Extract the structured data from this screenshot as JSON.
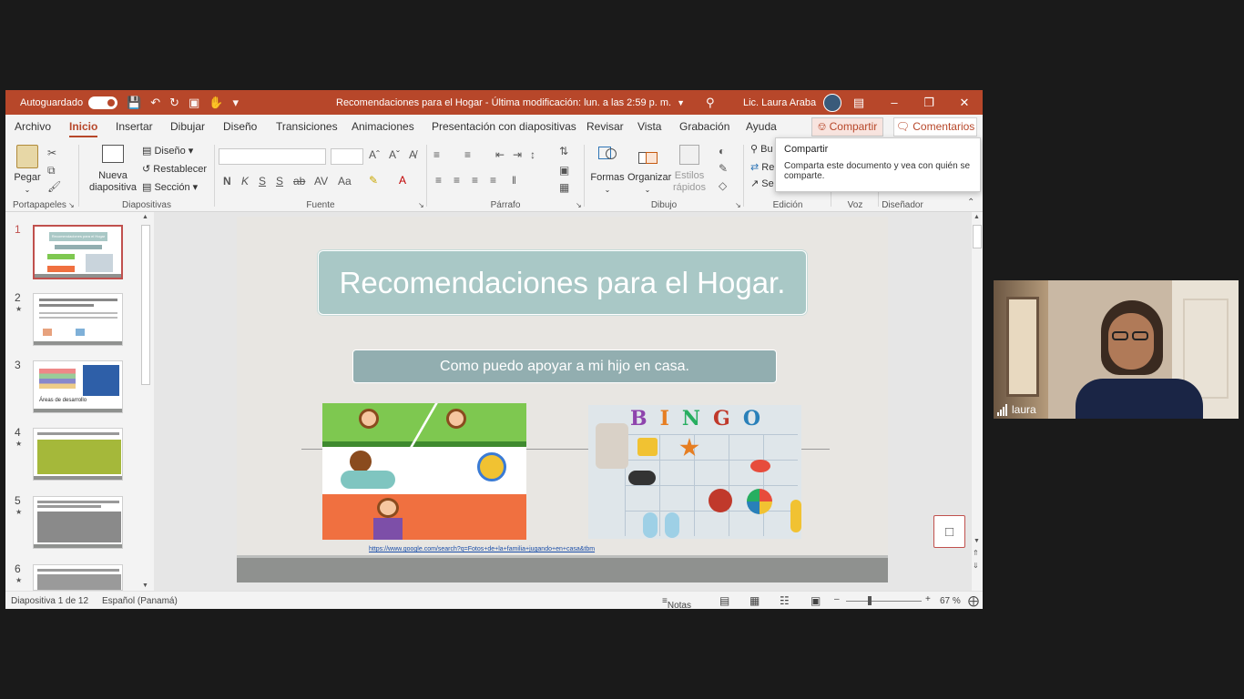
{
  "titlebar": {
    "autosave_label": "Autoguardado",
    "document_title": "Recomendaciones para el Hogar  -  Última modificación: lun. a las 2:59 p. m.",
    "user_name": "Lic. Laura Araba"
  },
  "menu": {
    "tabs": [
      "Archivo",
      "Inicio",
      "Insertar",
      "Dibujar",
      "Diseño",
      "Transiciones",
      "Animaciones",
      "Presentación con diapositivas",
      "Revisar",
      "Vista",
      "Grabación",
      "Ayuda"
    ],
    "active_tab": "Inicio",
    "share_label": "Compartir",
    "comments_label": "Comentarios"
  },
  "ribbon": {
    "paste_label": "Pegar",
    "new_slide_label": "Nueva diapositiva",
    "layout_label": "Diseño",
    "reset_label": "Restablecer",
    "section_label": "Sección",
    "shapes_label": "Formas",
    "arrange_label": "Organizar",
    "quick_styles_label": "Estilos rápidos",
    "find_label": "Bu",
    "replace_label": "Re",
    "select_label": "Se",
    "groups": {
      "portapapeles": "Portapapeles",
      "diapositivas": "Diapositivas",
      "fuente": "Fuente",
      "parrafo": "Párrafo",
      "dibujo": "Dibujo",
      "edicion": "Edición",
      "voz": "Voz",
      "disenador": "Diseñador"
    }
  },
  "tooltip": {
    "title": "Compartir",
    "body": "Comparta este documento y vea con quién se comparte."
  },
  "slides": {
    "numbers": [
      "1",
      "2",
      "3",
      "4",
      "5",
      "6"
    ],
    "thumb1_title": "Recomendaciones para el Hogar",
    "thumb3_caption": "Áreas de desarrollo"
  },
  "slide": {
    "title": "Recomendaciones para el Hogar.",
    "subtitle": "Como puedo apoyar a mi hijo en casa.",
    "bingo_letters": [
      "B",
      "I",
      "N",
      "G",
      "O"
    ],
    "link": "https://www.google.com/search?q=Fotos+de+la+familia+jugando+en+casa&tbm"
  },
  "statusbar": {
    "slide_count": "Diapositiva 1 de 12",
    "language": "Español (Panamá)",
    "notes_label": "Notas",
    "zoom": "67 %"
  },
  "video": {
    "participant_name": "laura"
  },
  "colors": {
    "accent": "#b7472a",
    "slide_title_box": "#a9c8c6",
    "slide_subtitle_box": "#92aeb0"
  }
}
